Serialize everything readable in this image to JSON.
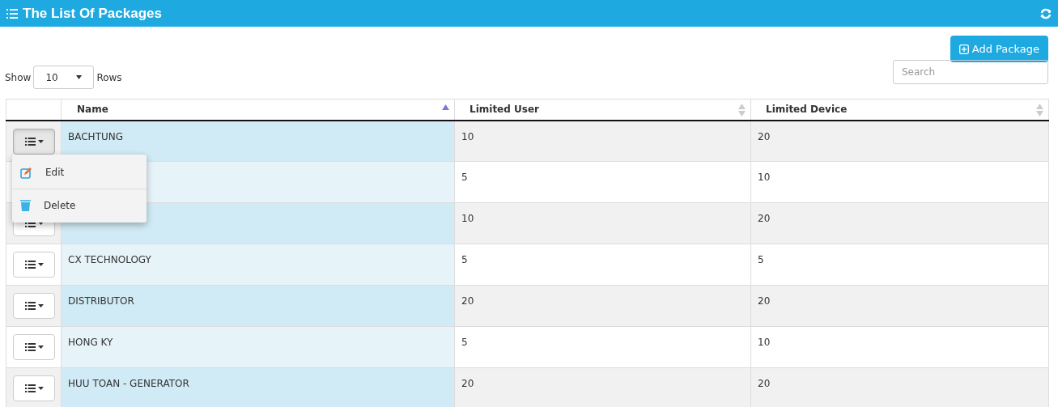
{
  "header": {
    "title": "The List Of Packages"
  },
  "toolbar": {
    "add_button": "Add Package",
    "show_label": "Show",
    "page_size": "10",
    "rows_label": "Rows",
    "search": {
      "placeholder": "Search"
    }
  },
  "table": {
    "columns": [
      {
        "label": "Name",
        "sorted": true
      },
      {
        "label": "Limited User",
        "sorted": false
      },
      {
        "label": "Limited Device",
        "sorted": false
      }
    ],
    "rows": [
      {
        "name": "BACHTUNG",
        "limited_user": "10",
        "limited_device": "20",
        "menu_open": true
      },
      {
        "limited_user": "5",
        "limited_device": "10"
      },
      {
        "limited_user": "10",
        "limited_device": "20",
        "menu_open": false
      },
      {
        "name": "CX TECHNOLOGY",
        "limited_user": "5",
        "limited_device": "5",
        "menu_open": false
      },
      {
        "name": "DISTRIBUTOR",
        "limited_user": "20",
        "limited_device": "20",
        "menu_open": false
      },
      {
        "name": "HONG KY",
        "limited_user": "5",
        "limited_device": "10",
        "menu_open": false
      },
      {
        "name": "HUU TOAN - GENERATOR",
        "limited_user": "20",
        "limited_device": "20",
        "menu_open": false
      }
    ]
  },
  "action_menu": {
    "items": [
      {
        "kind": "edit",
        "label": "Edit"
      },
      {
        "kind": "delete",
        "label": "Delete"
      }
    ]
  }
}
